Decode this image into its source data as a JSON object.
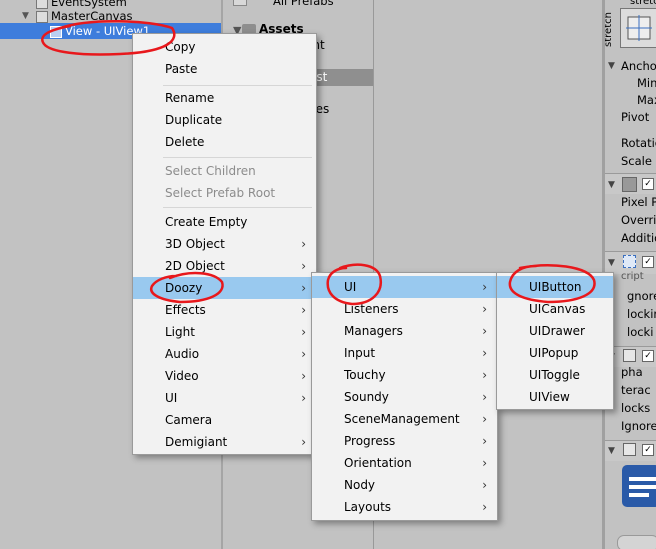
{
  "hierarchy": {
    "items": [
      {
        "label": "EventSystem"
      },
      {
        "label": "MasterCanvas"
      },
      {
        "label": "View - UIView1"
      }
    ]
  },
  "project": {
    "all_prefabs": "All Prefabs",
    "assets": "Assets",
    "frag1": "int",
    "frag2": "est",
    "frag3": "ces",
    "frag4": "s"
  },
  "inspector": {
    "stretch_top": "stretch",
    "stretch_side": "stretch",
    "anchor": "Ancho",
    "min": "Min",
    "max": "Max",
    "pivot": "Pivot",
    "rotation": "Rotatio",
    "scale": "Scale",
    "pixel": "Pixel P",
    "override": "Overri",
    "addition": "Additio",
    "script": "cript",
    "ignore": "gnore",
    "blocking1": "locking",
    "blocking2": "locki",
    "alpha": "pha",
    "interactable": "terac",
    "blocks": "locks",
    "ignore2": "Ignore"
  },
  "context_menu": {
    "groups": [
      [
        {
          "label": "Copy"
        },
        {
          "label": "Paste"
        }
      ],
      [
        {
          "label": "Rename"
        },
        {
          "label": "Duplicate"
        },
        {
          "label": "Delete"
        }
      ],
      [
        {
          "label": "Select Children"
        },
        {
          "label": "Select Prefab Root"
        }
      ],
      [
        {
          "label": "Create Empty"
        },
        {
          "label": "3D Object"
        },
        {
          "label": "2D Object"
        },
        {
          "label": "Doozy"
        },
        {
          "label": "Effects"
        },
        {
          "label": "Light"
        },
        {
          "label": "Audio"
        },
        {
          "label": "Video"
        },
        {
          "label": "UI"
        },
        {
          "label": "Camera"
        },
        {
          "label": "Demigiant"
        }
      ]
    ],
    "submenu_arrow": "›"
  },
  "doozy_menu": {
    "items": [
      {
        "label": "UI"
      },
      {
        "label": "Listeners"
      },
      {
        "label": "Managers"
      },
      {
        "label": "Input"
      },
      {
        "label": "Touchy"
      },
      {
        "label": "Soundy"
      },
      {
        "label": "SceneManagement"
      },
      {
        "label": "Progress"
      },
      {
        "label": "Orientation"
      },
      {
        "label": "Nody"
      },
      {
        "label": "Layouts"
      }
    ]
  },
  "ui_menu": {
    "items": [
      {
        "label": "UIButton"
      },
      {
        "label": "UICanvas"
      },
      {
        "label": "UIDrawer"
      },
      {
        "label": "UIPopup"
      },
      {
        "label": "UIToggle"
      },
      {
        "label": "UIView"
      }
    ]
  },
  "colors": {
    "selection": "#3e7ddc",
    "menu_highlight": "#99c9ef",
    "annotation": "#e8181c"
  }
}
